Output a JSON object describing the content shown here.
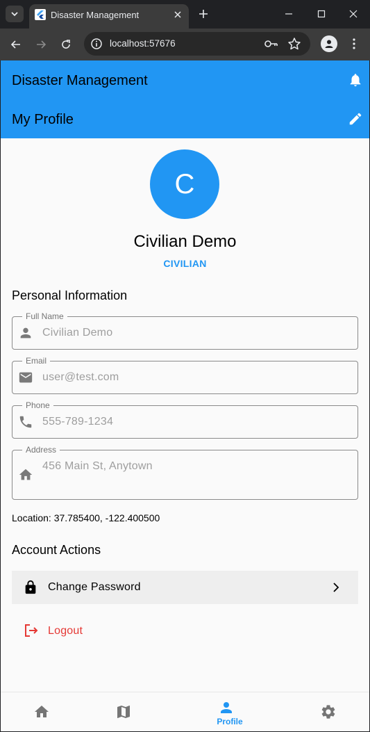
{
  "browser": {
    "tab_title": "Disaster Management",
    "url": "localhost:57676"
  },
  "app": {
    "title": "Disaster Management",
    "page_title": "My Profile"
  },
  "profile": {
    "avatar_letter": "C",
    "name": "Civilian Demo",
    "role": "CIVILIAN"
  },
  "personal_info": {
    "heading": "Personal Information",
    "fields": [
      {
        "label": "Full Name",
        "value": "Civilian Demo",
        "icon": "person-icon"
      },
      {
        "label": "Email",
        "value": "user@test.com",
        "icon": "email-icon"
      },
      {
        "label": "Phone",
        "value": "555-789-1234",
        "icon": "phone-icon"
      },
      {
        "label": "Address",
        "value": "456 Main St, Anytown",
        "icon": "home-icon"
      }
    ],
    "location": "Location: 37.785400, -122.400500"
  },
  "account_actions": {
    "heading": "Account Actions",
    "change_password": "Change Password",
    "logout": "Logout"
  },
  "bottom_nav": {
    "items": [
      {
        "icon": "home-icon",
        "label": ""
      },
      {
        "icon": "map-icon",
        "label": ""
      },
      {
        "icon": "person-icon",
        "label": "Profile"
      },
      {
        "icon": "settings-icon",
        "label": ""
      }
    ],
    "selected": 2
  },
  "colors": {
    "primary": "#2196f3",
    "danger": "#e53935",
    "background": "#fafafa"
  }
}
